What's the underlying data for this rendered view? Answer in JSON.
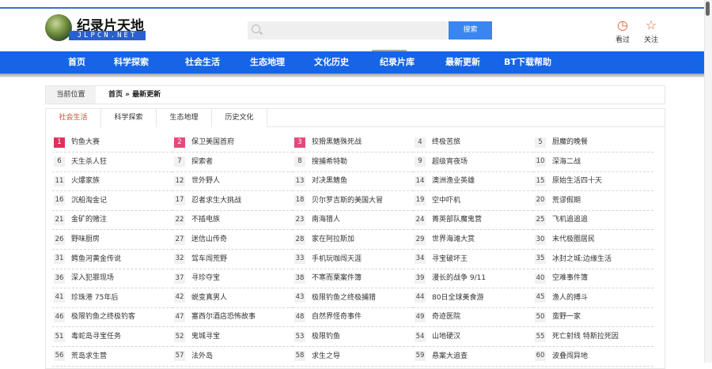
{
  "header": {
    "logo_cn": "纪录片天地",
    "logo_en": "JLPCN.NET",
    "search": {
      "placeholder": "",
      "button_label": "搜索"
    },
    "actions": [
      {
        "icon": "history-clock-icon",
        "label": "看过"
      },
      {
        "icon": "star-icon",
        "label": "关注"
      }
    ]
  },
  "colors": {
    "nav_bg": "#1565e6",
    "accent_red": "#e2412a",
    "badge_pink": "#e8497a",
    "icon_orange": "#e2612a"
  },
  "nav": {
    "items": [
      "首页",
      "科学探索",
      "社会生活",
      "生态地理",
      "文化历史",
      "纪录片库",
      "最新更新",
      "BT下载帮助"
    ],
    "active": "纪录片库"
  },
  "breadcrumb": {
    "label": "当前位置",
    "path": "首页 » 最新更新"
  },
  "tabs": {
    "items": [
      "社会生活",
      "科学探索",
      "生态地理",
      "历史文化"
    ],
    "active": "社会生活"
  },
  "list": [
    {
      "n": "1",
      "t": "钓鱼大赛"
    },
    {
      "n": "2",
      "t": "保卫美国首府"
    },
    {
      "n": "3",
      "t": "狡猾黑鳍殊死战"
    },
    {
      "n": "4",
      "t": "终极苦旅"
    },
    {
      "n": "5",
      "t": "厨魔的晚餐"
    },
    {
      "n": "6",
      "t": "天生杀人狂"
    },
    {
      "n": "7",
      "t": "探索者"
    },
    {
      "n": "8",
      "t": "搜捕希特勒"
    },
    {
      "n": "9",
      "t": "超级宵夜场"
    },
    {
      "n": "10",
      "t": "深海二战"
    },
    {
      "n": "11",
      "t": "火爆家族"
    },
    {
      "n": "12",
      "t": "世外野人"
    },
    {
      "n": "13",
      "t": "对决黑鳍鱼"
    },
    {
      "n": "14",
      "t": "澳洲渔业英雄"
    },
    {
      "n": "15",
      "t": "原始生活四十天"
    },
    {
      "n": "16",
      "t": "沉船淘金记"
    },
    {
      "n": "17",
      "t": "忍者求生大挑战"
    },
    {
      "n": "18",
      "t": "贝尔罗吉斯的美国大冒"
    },
    {
      "n": "19",
      "t": "空中吓机"
    },
    {
      "n": "20",
      "t": "荒谬假期"
    },
    {
      "n": "21",
      "t": "金矿的赌注"
    },
    {
      "n": "22",
      "t": "不插电族"
    },
    {
      "n": "23",
      "t": "南海猎人"
    },
    {
      "n": "24",
      "t": "菁英部队魔鬼营"
    },
    {
      "n": "25",
      "t": "飞机追追追"
    },
    {
      "n": "26",
      "t": "野味厨房"
    },
    {
      "n": "27",
      "t": "迷信山传奇"
    },
    {
      "n": "28",
      "t": "家在阿拉斯加"
    },
    {
      "n": "29",
      "t": "世界海滩大赏"
    },
    {
      "n": "30",
      "t": "末代极圈居民"
    },
    {
      "n": "31",
      "t": "鳄鱼河黄金传说"
    },
    {
      "n": "32",
      "t": "驾车闯荒野"
    },
    {
      "n": "33",
      "t": "手机玩咖闯天涯"
    },
    {
      "n": "34",
      "t": "寻宝破坏王"
    },
    {
      "n": "35",
      "t": "冰封之城:边缘生活"
    },
    {
      "n": "36",
      "t": "深入犯罪现场"
    },
    {
      "n": "37",
      "t": "寻珍夺宝"
    },
    {
      "n": "38",
      "t": "不寒而栗案件簿"
    },
    {
      "n": "39",
      "t": "漫长的战争 9/11"
    },
    {
      "n": "40",
      "t": "空难事件簿"
    },
    {
      "n": "41",
      "t": "珍珠港 75年后"
    },
    {
      "n": "42",
      "t": "蜕变真男人"
    },
    {
      "n": "43",
      "t": "极限钓鱼之终极捕猎"
    },
    {
      "n": "44",
      "t": "80日全球美食游"
    },
    {
      "n": "45",
      "t": "渔人的搏斗"
    },
    {
      "n": "46",
      "t": "极限钓鱼之终极钓客"
    },
    {
      "n": "47",
      "t": "塞西尔酒店恐怖故事"
    },
    {
      "n": "48",
      "t": "自然界怪奇事件"
    },
    {
      "n": "49",
      "t": "奇迹医院"
    },
    {
      "n": "50",
      "t": "蛮野一家"
    },
    {
      "n": "51",
      "t": "毒蛇岛寻宝任务"
    },
    {
      "n": "52",
      "t": "鬼城寻宝"
    },
    {
      "n": "53",
      "t": "极限钓鱼"
    },
    {
      "n": "54",
      "t": "山地硬汉"
    },
    {
      "n": "55",
      "t": "死亡射线 特斯拉死因"
    },
    {
      "n": "56",
      "t": "荒岛求生营"
    },
    {
      "n": "57",
      "t": "法外岛"
    },
    {
      "n": "58",
      "t": "求生之导"
    },
    {
      "n": "59",
      "t": "悬案大追查"
    },
    {
      "n": "60",
      "t": "波叠闯异地"
    }
  ]
}
